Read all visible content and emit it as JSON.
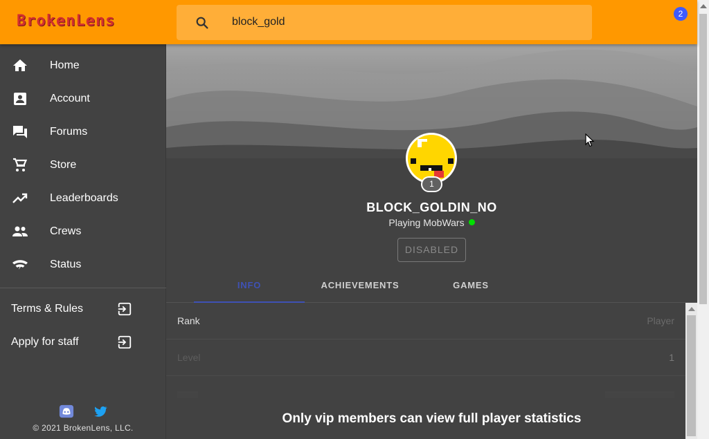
{
  "app": {
    "logo_text": "BrokenLens",
    "brand_color": "#ff9800"
  },
  "search": {
    "value": "block_gold",
    "icon": "search-icon"
  },
  "user": {
    "notification_count": "2"
  },
  "sidebar": {
    "items": [
      {
        "label": "Home",
        "icon": "home-icon"
      },
      {
        "label": "Account",
        "icon": "account-icon"
      },
      {
        "label": "Forums",
        "icon": "forum-icon"
      },
      {
        "label": "Store",
        "icon": "cart-icon"
      },
      {
        "label": "Leaderboards",
        "icon": "trending-up-icon"
      },
      {
        "label": "Crews",
        "icon": "people-icon"
      },
      {
        "label": "Status",
        "icon": "signal-icon"
      }
    ],
    "links": [
      {
        "label": "Terms & Rules",
        "icon": "exit-to-app-icon"
      },
      {
        "label": "Apply for staff",
        "icon": "exit-to-app-icon"
      }
    ],
    "social": [
      "discord-icon",
      "twitter-icon"
    ],
    "copyright": "© 2021 BrokenLens, LLC."
  },
  "profile": {
    "level": "1",
    "username": "BLOCK_GOLDIN_NO",
    "status": "Playing MobWars",
    "online_color": "#00e000",
    "action_label": "DISABLED"
  },
  "tabs": [
    {
      "label": "INFO",
      "active": true
    },
    {
      "label": "ACHIEVEMENTS",
      "active": false
    },
    {
      "label": "GAMES",
      "active": false
    }
  ],
  "stats": [
    {
      "key": "Rank",
      "value": "Player"
    },
    {
      "key": "Level",
      "value": "1"
    }
  ],
  "vip_message": "Only vip members can view full player statistics",
  "accent_color": "#3f51b5"
}
